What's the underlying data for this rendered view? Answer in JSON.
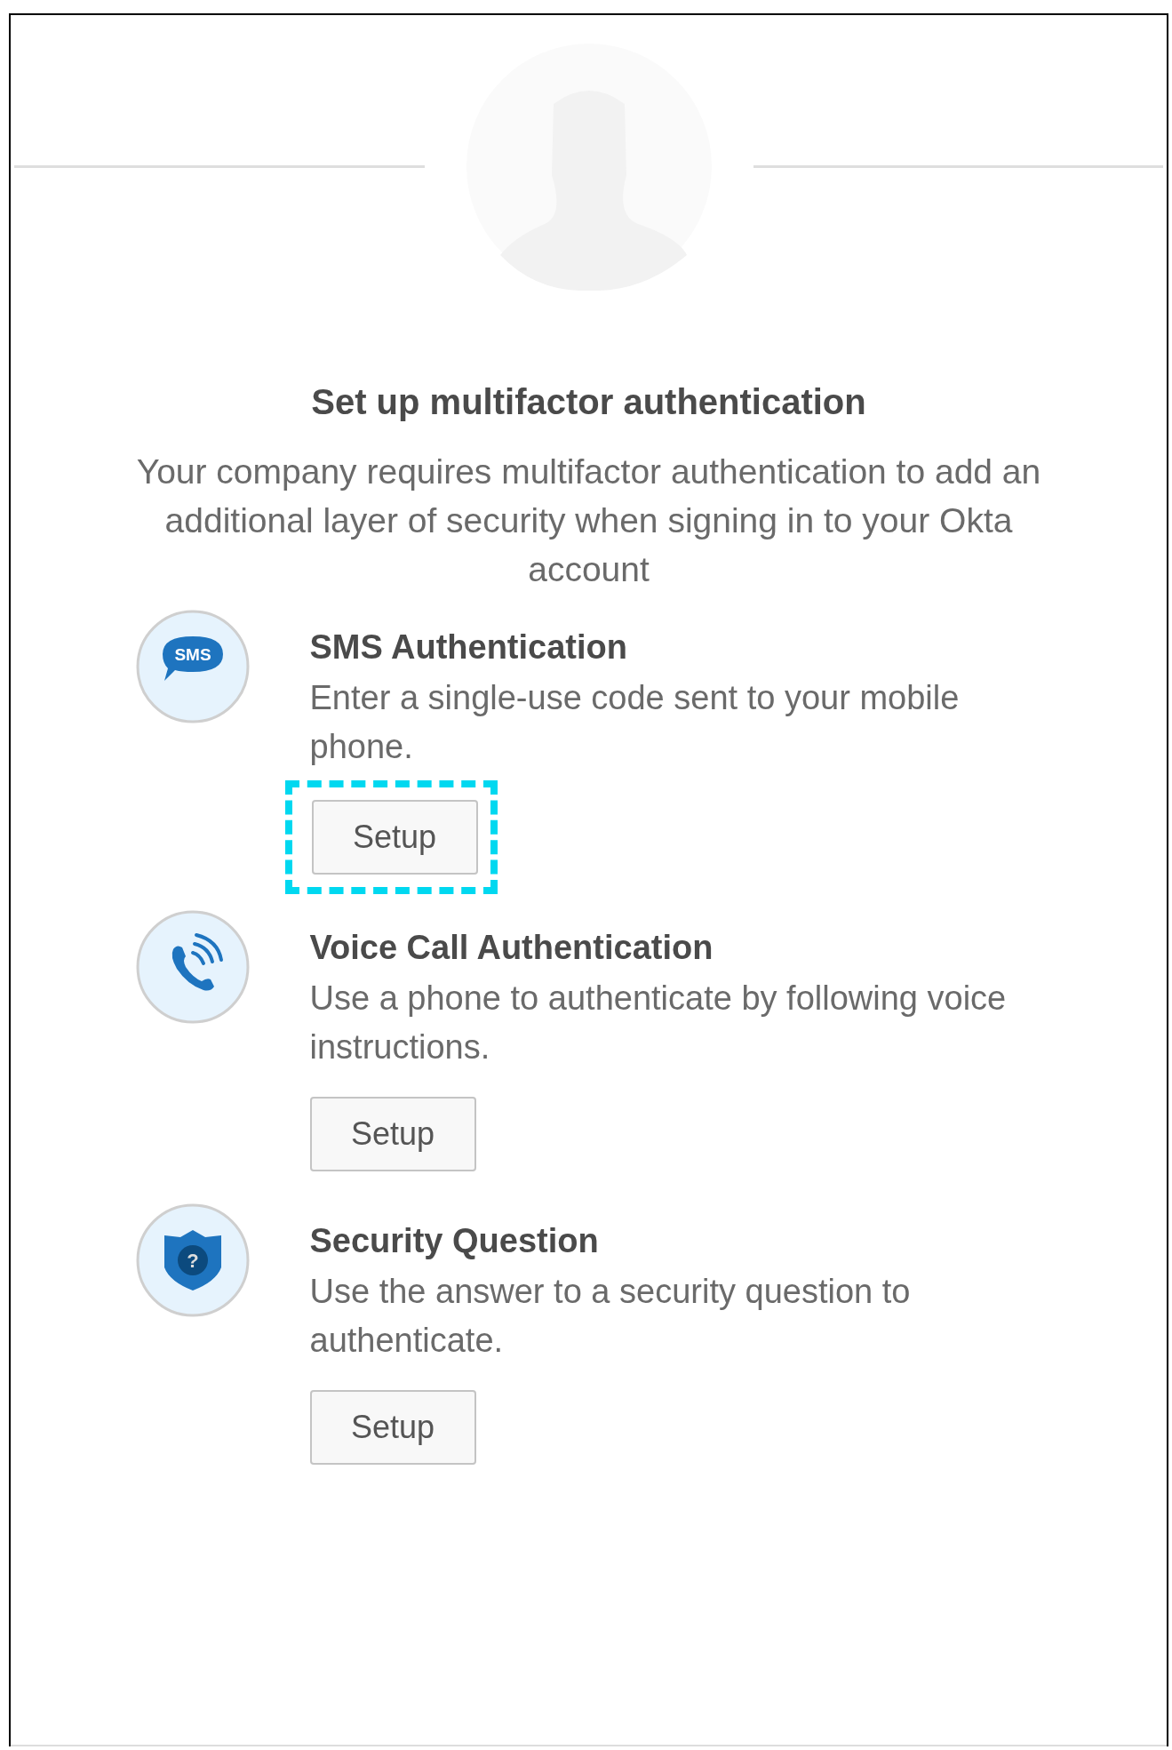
{
  "title": "Set up multifactor authentication",
  "description": "Your company requires multifactor authentication to add an additional layer of security when signing in to your Okta account",
  "factors": [
    {
      "kind": "sms",
      "icon_text": "SMS",
      "name": "SMS Authentication",
      "description": "Enter a single-use code sent to your mobile phone.",
      "button": "Setup",
      "highlighted": true
    },
    {
      "kind": "voice",
      "name": "Voice Call Authentication",
      "description": "Use a phone to authenticate by following voice instructions.",
      "button": "Setup",
      "highlighted": false
    },
    {
      "kind": "question",
      "icon_text": "?",
      "name": "Security Question",
      "description": "Use the answer to a security question to authenticate.",
      "button": "Setup",
      "highlighted": false
    }
  ]
}
